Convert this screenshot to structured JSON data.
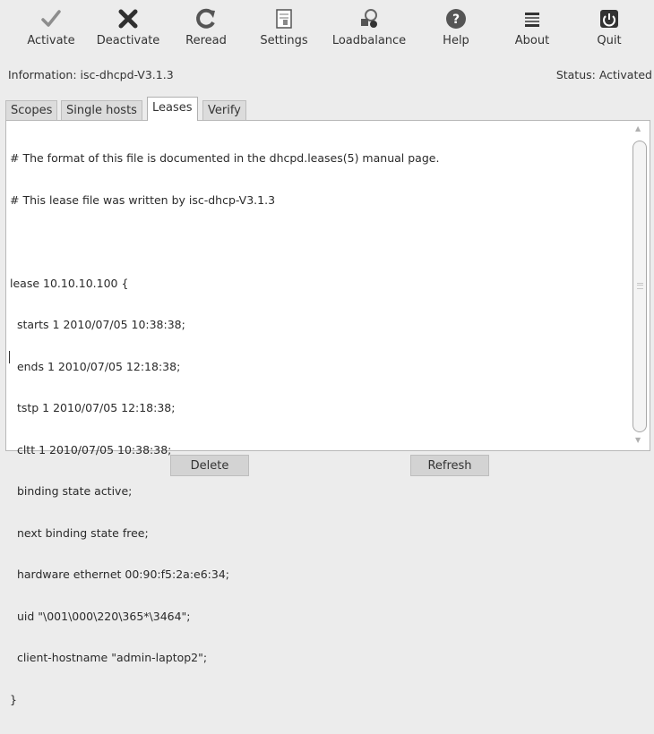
{
  "toolbar": {
    "activate": "Activate",
    "deactivate": "Deactivate",
    "reread": "Reread",
    "settings": "Settings",
    "loadbalance": "Loadbalance",
    "help": "Help",
    "about": "About",
    "quit": "Quit"
  },
  "info": {
    "information": "Information: isc-dhcpd-V3.1.3",
    "status": "Status: Activated"
  },
  "tabs": [
    "Scopes",
    "Single hosts",
    "Leases",
    "Verify"
  ],
  "editor": {
    "lines": [
      "# The format of this file is documented in the dhcpd.leases(5) manual page.",
      "# This lease file was written by isc-dhcp-V3.1.3",
      "",
      "lease 10.10.10.100 {",
      "  starts 1 2010/07/05 10:38:38;",
      "  ends 1 2010/07/05 12:18:38;",
      "  tstp 1 2010/07/05 12:18:38;",
      "  cltt 1 2010/07/05 10:38:38;",
      "  binding state active;",
      "  next binding state free;",
      "  hardware ethernet 00:90:f5:2a:e6:34;",
      "  uid \"\\001\\000\\220\\365*\\3464\";",
      "  client-hostname \"admin-laptop2\";",
      "}"
    ]
  },
  "buttons": {
    "delete": "Delete",
    "refresh": "Refresh"
  },
  "icons": {
    "activate": "check-icon",
    "deactivate": "x-icon",
    "reread": "reload-icon",
    "settings": "settings-icon",
    "loadbalance": "loadbalance-icon",
    "help": "help-icon",
    "about": "about-icon",
    "quit": "power-icon"
  }
}
